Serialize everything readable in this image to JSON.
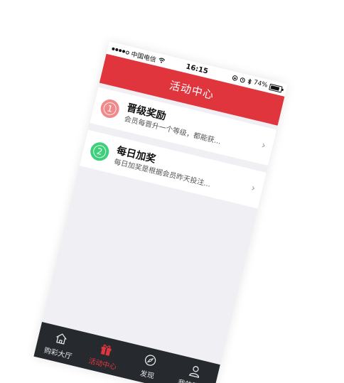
{
  "status_bar": {
    "carrier": "中国电信",
    "time": "16:15",
    "battery_percent": "74%"
  },
  "nav": {
    "title": "活动中心"
  },
  "items": [
    {
      "index": "1",
      "title": "晋级奖励",
      "description": "会员每晋升一个等级，都能获...",
      "badge_color": "#f08a8a"
    },
    {
      "index": "2",
      "title": "每日加奖",
      "description": "每日加奖是根据会员昨天投注...",
      "badge_color": "#3ecf7a"
    }
  ],
  "tabs": [
    {
      "label": "购彩大厅",
      "icon": "home-icon",
      "active": false
    },
    {
      "label": "活动中心",
      "icon": "gift-icon",
      "active": true
    },
    {
      "label": "发现",
      "icon": "compass-icon",
      "active": false
    },
    {
      "label": "我的账户",
      "icon": "user-icon",
      "active": false
    }
  ],
  "colors": {
    "accent": "#e1353e",
    "tab_bar": "#262a2e",
    "background": "#efeff4"
  }
}
